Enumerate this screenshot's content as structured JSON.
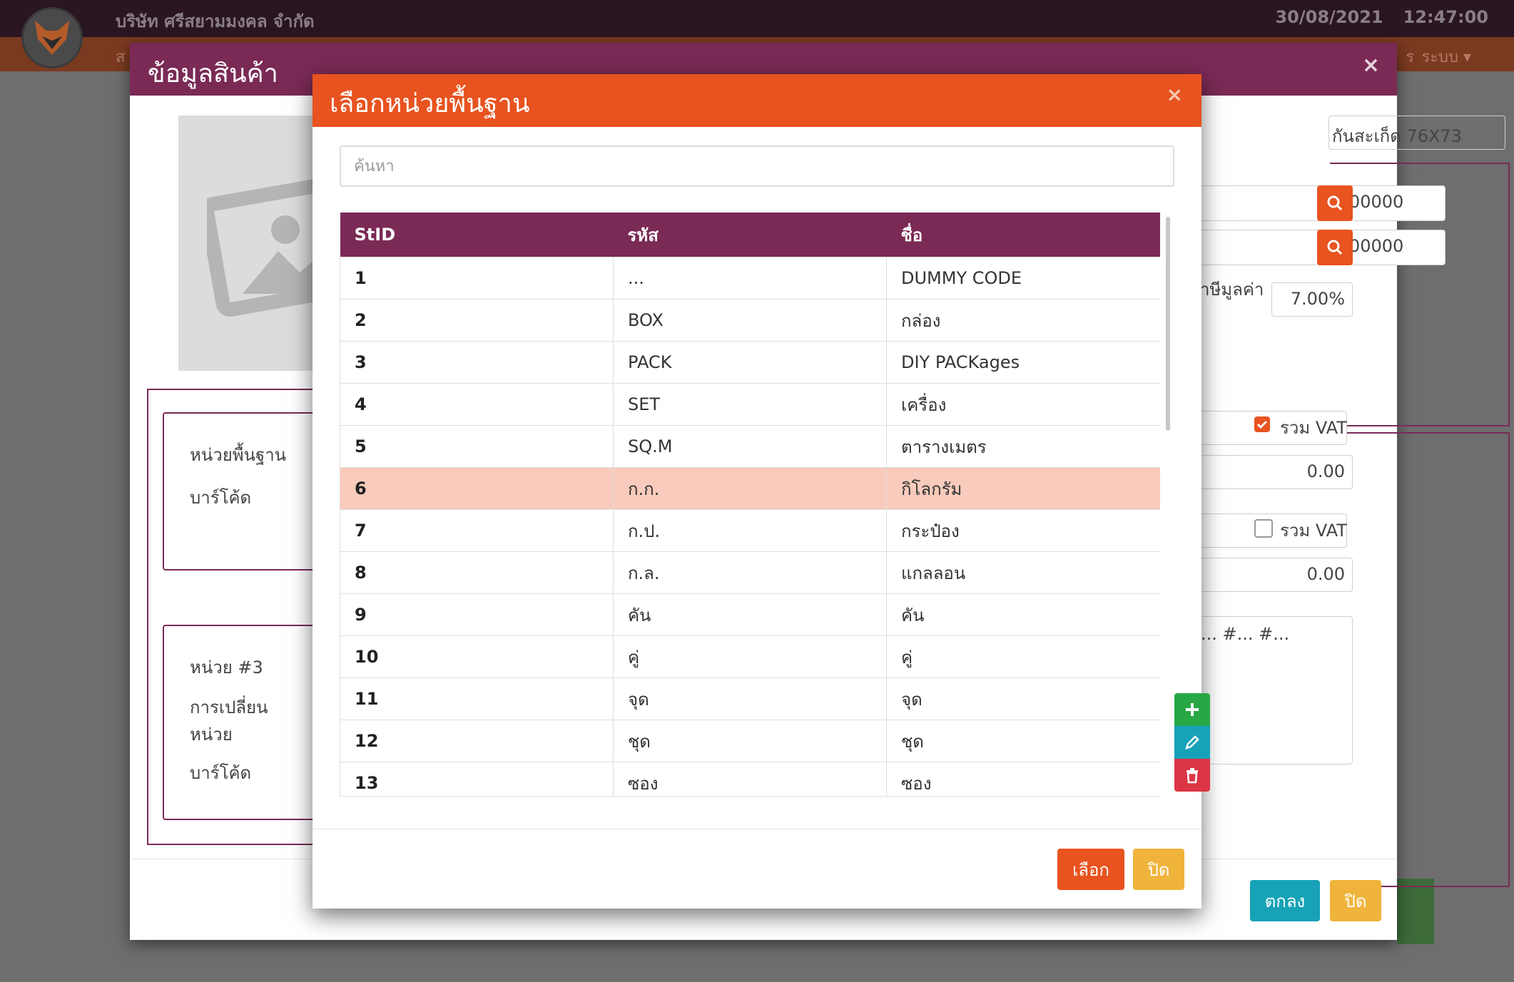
{
  "app": {
    "company": "บริษัท ศรีสยามมงคล จำกัด",
    "date": "30/08/2021",
    "time": "12:47:00",
    "menu_left": "ส",
    "menu_right": "ร",
    "menu_system": "ระบบ ▾"
  },
  "outer_modal": {
    "title": "ข้อมูลสินค้า",
    "close": "×",
    "name_value": "กันสะเก็ด 76X73",
    "code1": "0-00000",
    "code2": "0-00000",
    "vat_rate_label": "าษีมูลค่า",
    "vat_rate_value": "7.00%",
    "vat_label_1": "รวม VAT",
    "vat_label_2": "รวม VAT",
    "price1": "0.00",
    "price2": "0.00",
    "note_partial": "... #... #...",
    "labels": {
      "base_unit": "หน่วยพื้นฐาน",
      "barcode1": "บาร์โค้ด",
      "unit3": "หน่วย #3",
      "conversion_line1": "การเปลี่ยน",
      "conversion_line2": "หน่วย",
      "barcode2": "บาร์โค้ด"
    },
    "ok_button": "ตกลง",
    "close_button": "ปิด"
  },
  "inner_modal": {
    "title": "เลือกหน่วยพื้นฐาน",
    "close": "×",
    "search_placeholder": "ค้นหา",
    "columns": [
      "StID",
      "รหัส",
      "ชื่อ"
    ],
    "rows": [
      {
        "id": "1",
        "code": "...",
        "name": "DUMMY CODE"
      },
      {
        "id": "2",
        "code": "BOX",
        "name": "กล่อง"
      },
      {
        "id": "3",
        "code": "PACK",
        "name": "DIY PACKages"
      },
      {
        "id": "4",
        "code": "SET",
        "name": "เครื่อง"
      },
      {
        "id": "5",
        "code": "SQ.M",
        "name": "ตารางเมตร"
      },
      {
        "id": "6",
        "code": "ก.ก.",
        "name": "กิโลกรัม"
      },
      {
        "id": "7",
        "code": "ก.ป.",
        "name": "กระป๋อง"
      },
      {
        "id": "8",
        "code": "ก.ล.",
        "name": "แกลลอน"
      },
      {
        "id": "9",
        "code": "คัน",
        "name": "คัน"
      },
      {
        "id": "10",
        "code": "คู่",
        "name": "คู่"
      },
      {
        "id": "11",
        "code": "จุด",
        "name": "จุด"
      },
      {
        "id": "12",
        "code": "ชุด",
        "name": "ชุด"
      },
      {
        "id": "13",
        "code": "ซอง",
        "name": "ซอง"
      }
    ],
    "selected_row": "6",
    "select_button": "เลือก",
    "close_button": "ปิด"
  },
  "colors": {
    "header_purple": "#7a2a55",
    "accent_orange": "#e8531f",
    "selected_row": "#f8cbbc",
    "teal_button": "#17a2b8",
    "yellow_button": "#f0b43c",
    "green_button": "#28a745",
    "red_button": "#dc3545"
  },
  "icons": [
    "fox-logo-icon",
    "image-placeholder-icon",
    "search-icon",
    "plus-icon",
    "pencil-icon",
    "trash-icon",
    "check-icon"
  ]
}
